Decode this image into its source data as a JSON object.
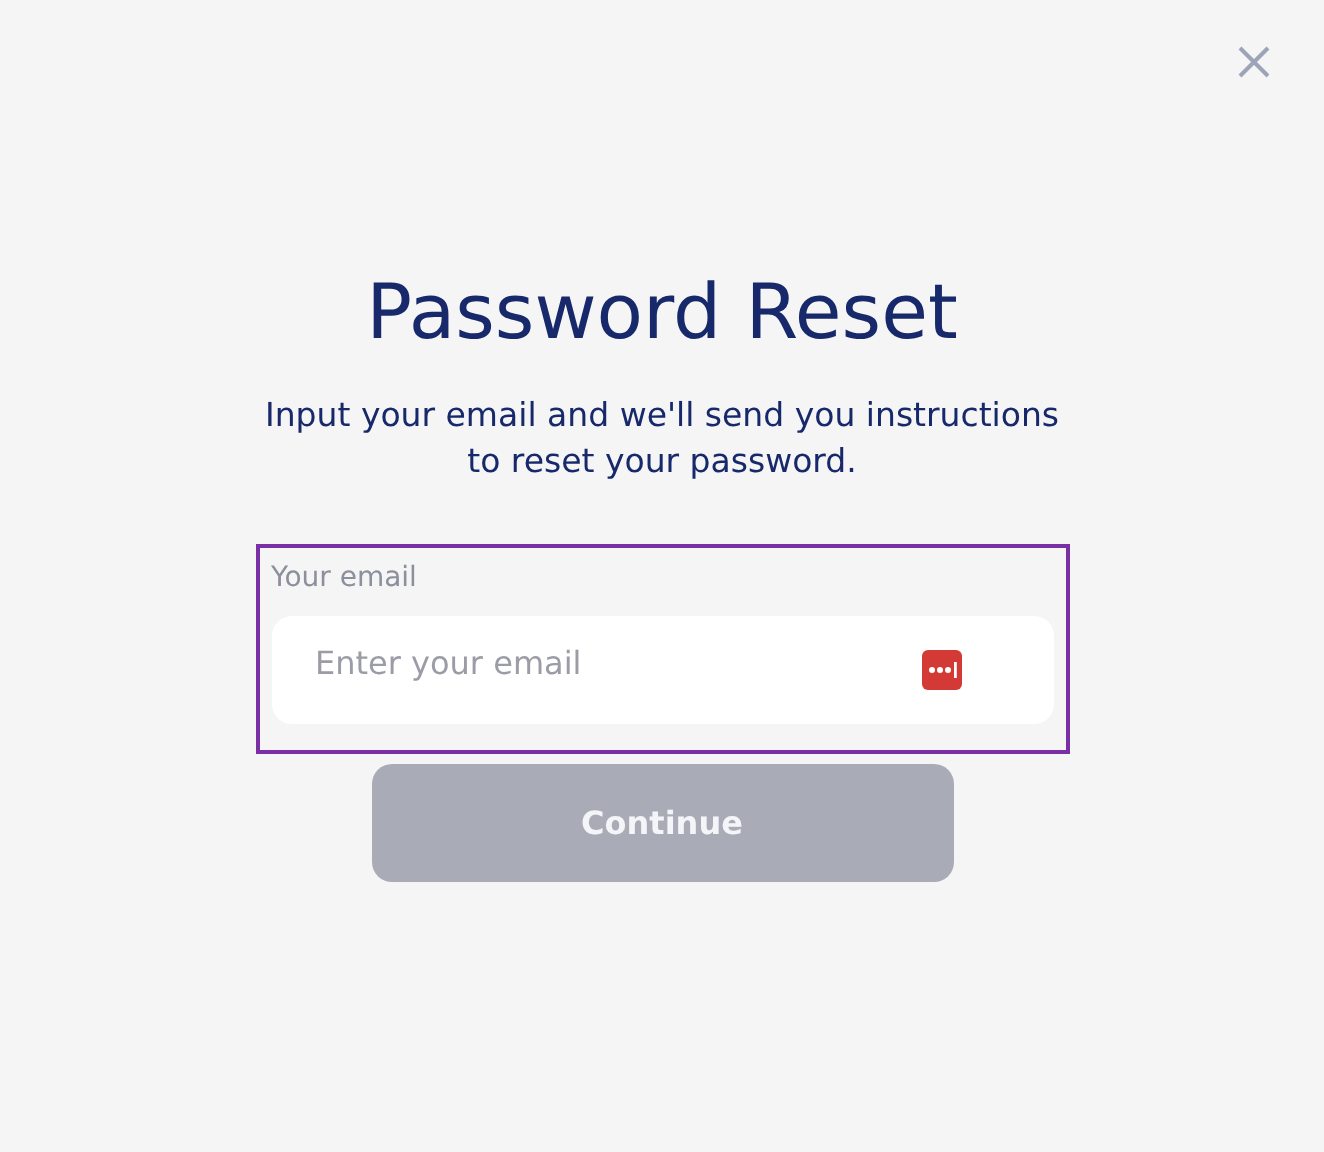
{
  "title": "Password Reset",
  "subtitle": "Input your email and we'll send you instructions to reset your password.",
  "email_field": {
    "label": "Your email",
    "placeholder": "Enter your email",
    "focused": true
  },
  "continue_button": {
    "label": "Continue",
    "disabled": true
  }
}
